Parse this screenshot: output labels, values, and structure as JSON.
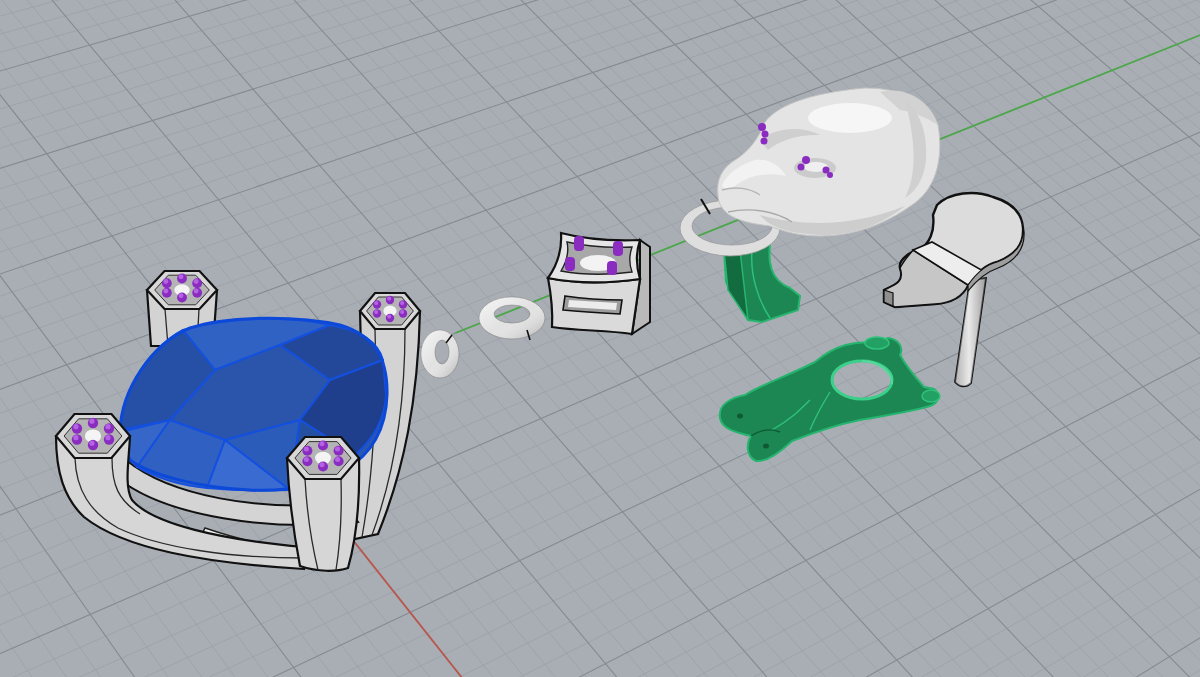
{
  "viewport": {
    "grid": {
      "visible": true
    },
    "axes": [
      {
        "kind": "x",
        "color": "#b8584e"
      },
      {
        "kind": "y",
        "color": "#4da84a"
      }
    ],
    "objects": [
      {
        "kind": "gem_setting",
        "color": "#2a58b0"
      },
      {
        "kind": "jump_ring",
        "color": "#e2e2e2"
      },
      {
        "kind": "jump_ring",
        "color": "#e2e2e2"
      },
      {
        "kind": "bead_setting",
        "color": "#dadada"
      },
      {
        "kind": "lion_head",
        "color": "#e4e4e4"
      },
      {
        "kind": "bail",
        "color": "#1c8752"
      },
      {
        "kind": "clasp",
        "color": "#1c8752"
      },
      {
        "kind": "pendant_plate",
        "color": "#dcdcdc"
      },
      {
        "kind": "pin_post",
        "color": "#d2d2d2"
      }
    ]
  }
}
